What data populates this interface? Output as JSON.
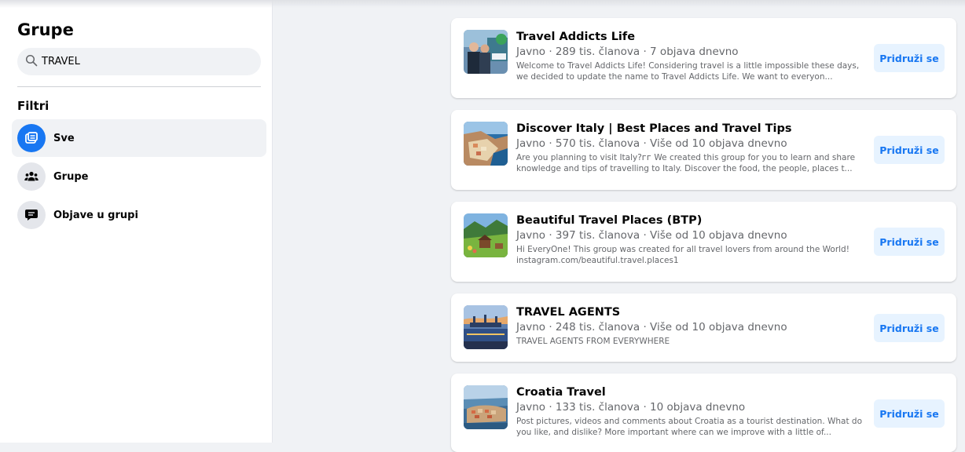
{
  "sidebar": {
    "title": "Grupe",
    "search": {
      "value": "TRAVEL"
    },
    "filters_label": "Filtri",
    "filters": [
      {
        "label": "Sve",
        "icon": "all-results-icon",
        "active": true
      },
      {
        "label": "Grupe",
        "icon": "groups-icon",
        "active": false
      },
      {
        "label": "Objave u grupi",
        "icon": "group-posts-icon",
        "active": false
      }
    ]
  },
  "results": [
    {
      "title": "Travel Addicts Life",
      "meta": "Javno · 289 tis. članova · 7 objava dnevno",
      "desc": "Welcome to Travel Addicts Life! Considering travel is a little impossible these days, we decided to update the name to Travel Addicts Life. We want to everyon...",
      "button": "Pridruži se"
    },
    {
      "title": "Discover Italy | Best Places and Travel Tips",
      "meta": "Javno · 570 tis. članova · Više od 10 objava dnevno",
      "desc": "Are you planning to visit Italy?ᴦᴦ We created this group for you to learn and share knowledge and tips of travelling to Italy. Discover the food, the people, places t...",
      "button": "Pridruži se"
    },
    {
      "title": "Beautiful Travel Places (BTP)",
      "meta": "Javno · 397 tis. članova · Više od 10 objava dnevno",
      "desc": "Hi EveryOne! This group was created for all travel lovers from around the World! instagram.com/beautiful.travel.places1",
      "button": "Pridruži se"
    },
    {
      "title": "TRAVEL AGENTS",
      "meta": "Javno · 248 tis. članova · Više od 10 objava dnevno",
      "desc": "TRAVEL AGENTS FROM EVERYWHERE",
      "button": "Pridruži se"
    },
    {
      "title": "Croatia Travel",
      "meta": "Javno · 133 tis. članova · 10 objava dnevno",
      "desc": "Post pictures, videos and comments about Croatia as a tourist destination. What do you like, and dislike? More important where can we improve with a little of...",
      "button": "Pridruži se"
    }
  ],
  "colors": {
    "accent": "#1877f2",
    "button_bg": "#e7f3ff",
    "page_bg": "#f0f2f5"
  }
}
